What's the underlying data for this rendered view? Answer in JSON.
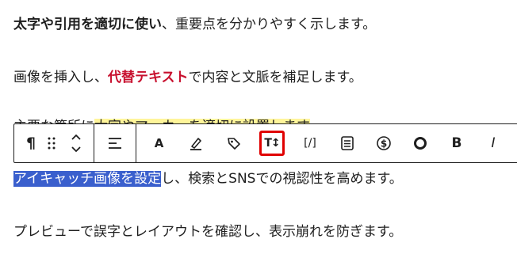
{
  "paragraphs": {
    "p1": {
      "bold": "太字や引用を適切に使い",
      "rest": "、重要点を分かりやすく示します。"
    },
    "p2": {
      "before": "画像を挿入し、",
      "highlight": "代替テキスト",
      "after": "で内容と文脈を補足します。"
    },
    "p3": {
      "before": "主要な箇所に",
      "highlight": "太字やマーカーを適切に設置します"
    },
    "p4": {
      "selected": "アイキャッチ画像を設定",
      "after": "し、検索とSNSでの視認性を高めます。"
    },
    "p5": {
      "text": "プレビューで誤字とレイアウトを確認し、表示崩れを防ぎます。"
    }
  },
  "toolbar": {
    "paragraph_glyph": "¶",
    "text_color_glyph": "A",
    "bold_glyph": "B",
    "italic_glyph": "I",
    "inline_code_glyph": "[/]",
    "active_tool": "font-size-icon"
  },
  "colors": {
    "highlight_red": "#c8102e",
    "marker_yellow": "#fff59a",
    "selection_blue": "#3a5fcd",
    "active_border": "#e00000"
  }
}
